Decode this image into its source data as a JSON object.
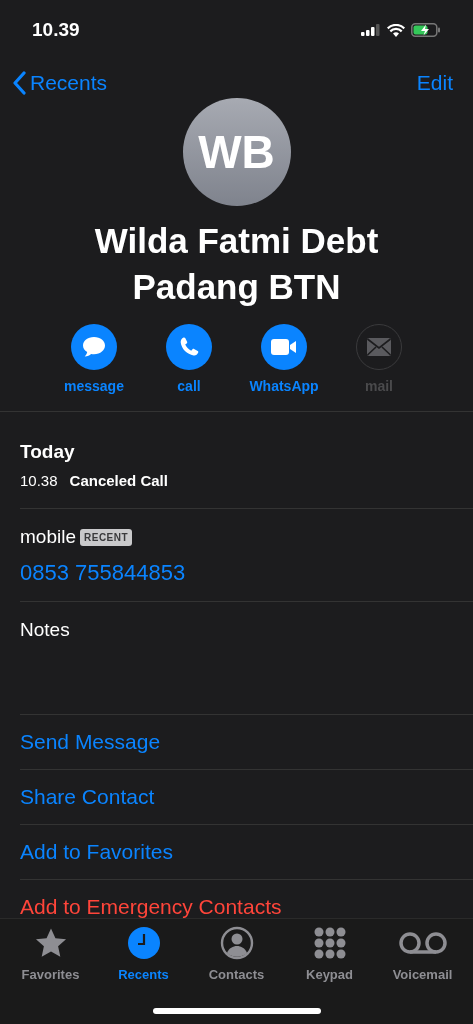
{
  "status_bar": {
    "time": "10.39"
  },
  "nav": {
    "back": "Recents",
    "edit": "Edit"
  },
  "contact": {
    "initials": "WB",
    "name_lines": [
      "Wilda Fatmi Debt",
      "Padang BTN"
    ]
  },
  "actions": [
    {
      "kind": "message",
      "label": "message",
      "disabled": false
    },
    {
      "kind": "call",
      "label": "call",
      "disabled": false
    },
    {
      "kind": "video",
      "label": "WhatsApp",
      "disabled": false
    },
    {
      "kind": "mail",
      "label": "mail",
      "disabled": true
    }
  ],
  "history": {
    "heading": "Today",
    "entries": [
      {
        "time": "10.38",
        "status": "Canceled Call"
      }
    ]
  },
  "phone": {
    "label": "mobile",
    "badge": "RECENT",
    "number": "0853 755844853"
  },
  "notes": {
    "label": "Notes"
  },
  "links": [
    {
      "label": "Send Message",
      "destructive": false
    },
    {
      "label": "Share Contact",
      "destructive": false
    },
    {
      "label": "Add to Favorites",
      "destructive": false
    },
    {
      "label": "Add to Emergency Contacts",
      "destructive": true
    }
  ],
  "tabs": [
    {
      "kind": "favorites",
      "label": "Favorites",
      "selected": false
    },
    {
      "kind": "recents",
      "label": "Recents",
      "selected": true
    },
    {
      "kind": "contacts",
      "label": "Contacts",
      "selected": false
    },
    {
      "kind": "keypad",
      "label": "Keypad",
      "selected": false
    },
    {
      "kind": "voicemail",
      "label": "Voicemail",
      "selected": false
    }
  ]
}
